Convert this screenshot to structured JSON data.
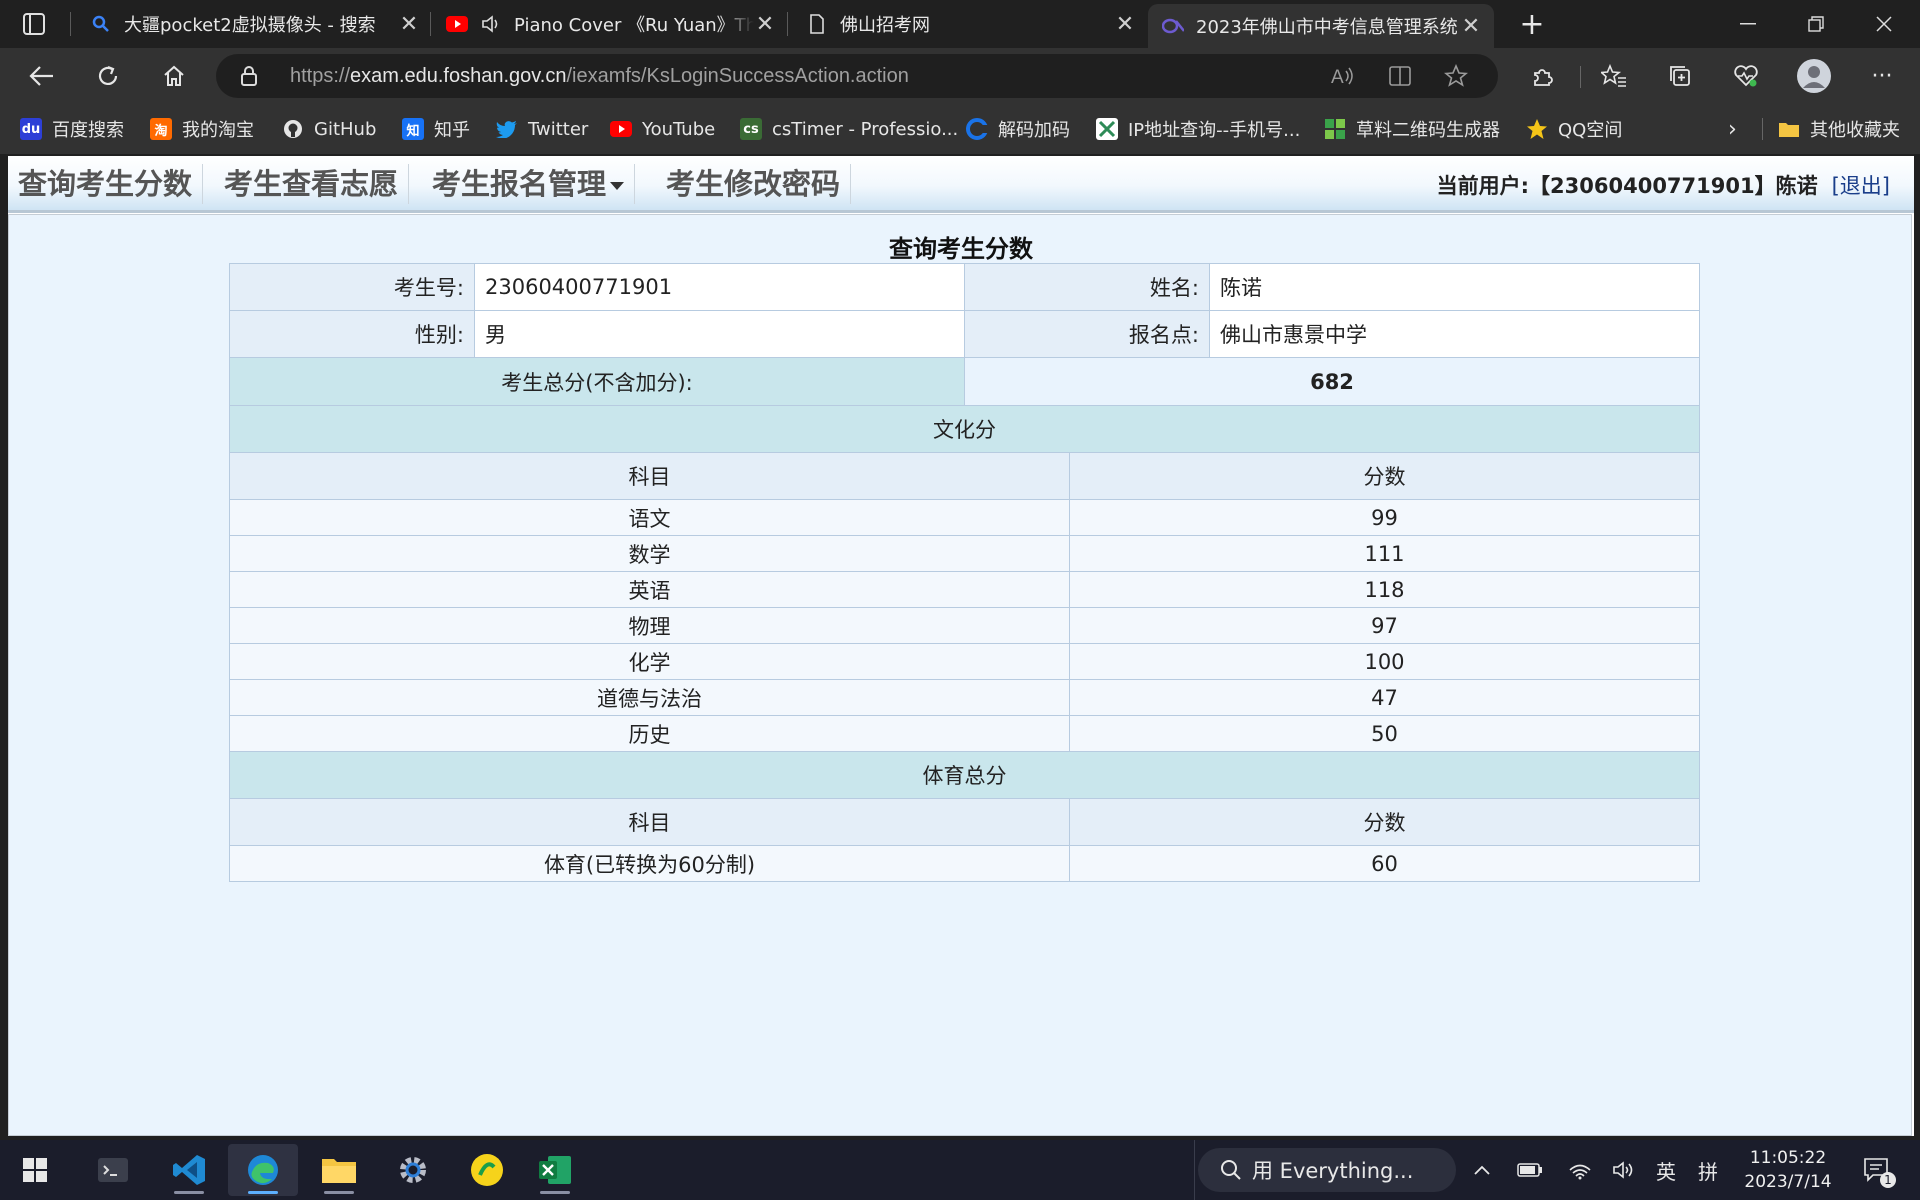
{
  "browser": {
    "tabs": [
      {
        "title": "大疆pocket2虚拟摄像头 - 搜索",
        "icon": "search-icon"
      },
      {
        "title": "Piano Cover 《Ru Yuan》Th",
        "icon": "youtube-icon"
      },
      {
        "title": "佛山招考网",
        "icon": "page-icon"
      },
      {
        "title": "2023年佛山市中考信息管理系统",
        "icon": "site-logo-icon"
      }
    ],
    "new_tab": "+",
    "url_prefix": "https://",
    "url_host": "exam.edu.foshan.gov.cn",
    "url_path": "/iexamfs/KsLoginSuccessAction.action",
    "favorites": [
      {
        "label": "百度搜索",
        "icon": "baidu-icon",
        "badge": "du",
        "color": "#2d3fd6"
      },
      {
        "label": "我的淘宝",
        "icon": "taobao-icon",
        "badge": "淘",
        "color": "#ff6a00"
      },
      {
        "label": "GitHub",
        "icon": "github-icon",
        "badge": "",
        "color": "#ffffff"
      },
      {
        "label": "知乎",
        "icon": "zhihu-icon",
        "badge": "知",
        "color": "#1772f6"
      },
      {
        "label": "Twitter",
        "icon": "twitter-icon",
        "badge": "",
        "color": "#1d9bf0"
      },
      {
        "label": "YouTube",
        "icon": "youtube-icon",
        "badge": "",
        "color": "#ff0000"
      },
      {
        "label": "csTimer - Professio...",
        "icon": "cstimer-icon",
        "badge": "cs",
        "color": "#3a6b35"
      },
      {
        "label": "解码加码",
        "icon": "decode-icon",
        "badge": "",
        "color": "#1a73e8"
      },
      {
        "label": "IP地址查询--手机号...",
        "icon": "ip-lookup-icon",
        "badge": "",
        "color": "#2e8b57"
      },
      {
        "label": "草料二维码生成器",
        "icon": "qr-code-icon",
        "badge": "",
        "color": "#3aa34a"
      },
      {
        "label": "QQ空间",
        "icon": "qzone-star-icon",
        "badge": "★",
        "color": "#f5c518"
      }
    ],
    "other_favorites": "其他收藏夹"
  },
  "page": {
    "menu": [
      {
        "label": "查询考生分数"
      },
      {
        "label": "考生查看志愿"
      },
      {
        "label": "考生报名管理"
      },
      {
        "label": "考生修改密码"
      }
    ],
    "user_prefix": "当前用户:",
    "user_value": "【23060400771901】陈诺",
    "logout": "[退出]",
    "title": "查询考生分数",
    "student_id_label": "考生号:",
    "student_id": "23060400771901",
    "name_label": "姓名:",
    "name": "陈诺",
    "gender_label": "性别:",
    "gender": "男",
    "site_label": "报名点:",
    "site": "佛山市惠景中学",
    "total_label": "考生总分(不含加分):",
    "total": "682",
    "culture_section": "文化分",
    "subject_header": "科目",
    "score_header": "分数",
    "culture_scores": [
      {
        "subject": "语文",
        "score": "99"
      },
      {
        "subject": "数学",
        "score": "111"
      },
      {
        "subject": "英语",
        "score": "118"
      },
      {
        "subject": "物理",
        "score": "97"
      },
      {
        "subject": "化学",
        "score": "100"
      },
      {
        "subject": "道德与法治",
        "score": "47"
      },
      {
        "subject": "历史",
        "score": "50"
      }
    ],
    "pe_section": "体育总分",
    "pe_scores": [
      {
        "subject": "体育(已转换为60分制)",
        "score": "60"
      }
    ]
  },
  "taskbar": {
    "search_placeholder": "用 Everything...",
    "ime_lang": "英",
    "ime_mode": "拼",
    "time": "11:05:22",
    "date": "2023/7/14",
    "notification_count": "1"
  }
}
